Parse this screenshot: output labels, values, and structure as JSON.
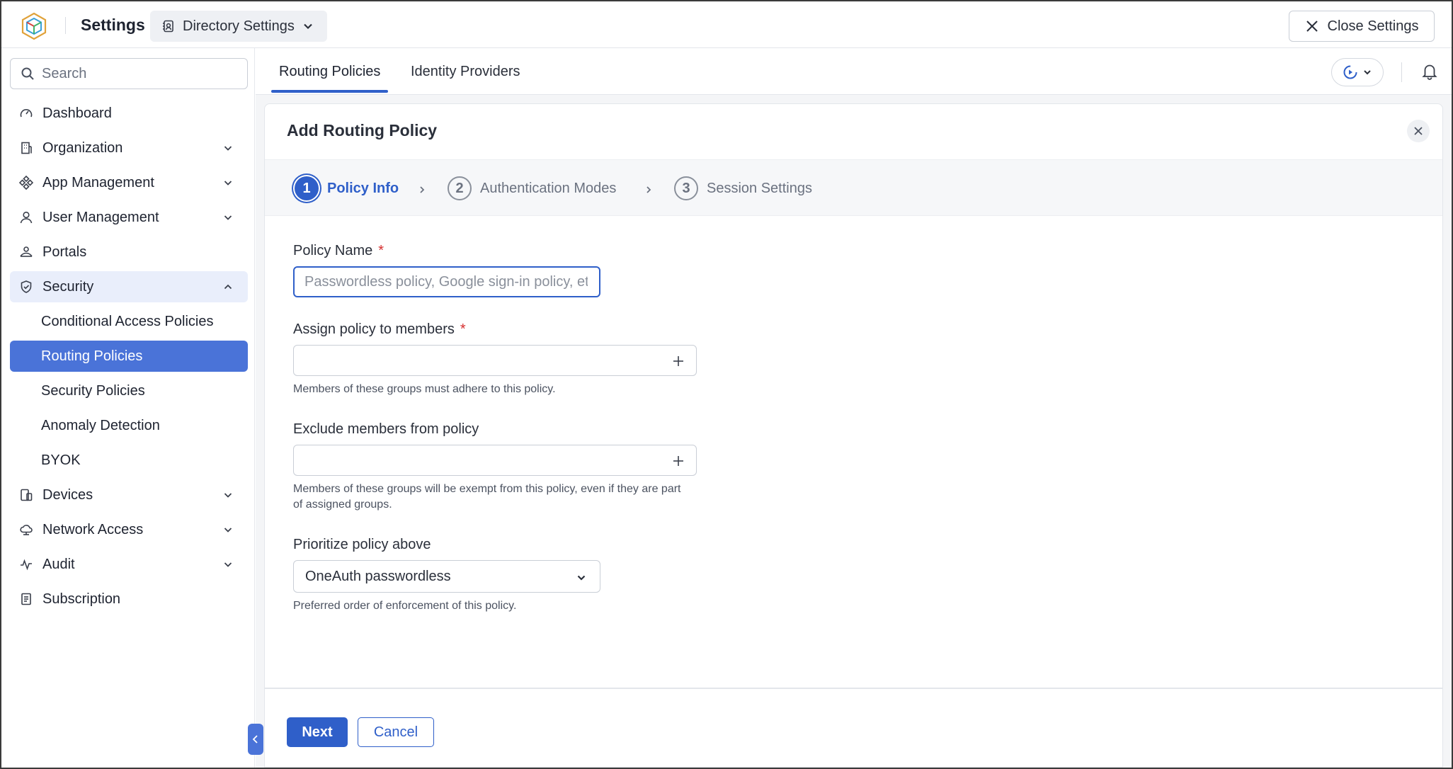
{
  "header": {
    "app_title": "Settings",
    "directory_switch": "Directory Settings",
    "close_label": "Close Settings"
  },
  "sidebar": {
    "search_placeholder": "Search",
    "items": [
      {
        "label": "Dashboard",
        "icon": "gauge-icon"
      },
      {
        "label": "Organization",
        "icon": "building-icon"
      },
      {
        "label": "App Management",
        "icon": "apps-icon"
      },
      {
        "label": "User Management",
        "icon": "user-icon"
      },
      {
        "label": "Portals",
        "icon": "portal-icon"
      },
      {
        "label": "Security",
        "icon": "shield-icon"
      },
      {
        "label": "Devices",
        "icon": "devices-icon"
      },
      {
        "label": "Network Access",
        "icon": "cloud-icon"
      },
      {
        "label": "Audit",
        "icon": "activity-icon"
      },
      {
        "label": "Subscription",
        "icon": "document-icon"
      }
    ],
    "security_subitems": [
      "Conditional Access Policies",
      "Routing Policies",
      "Security Policies",
      "Anomaly Detection",
      "BYOK"
    ],
    "accent": "#4a73d8"
  },
  "tabs": {
    "routing": "Routing Policies",
    "idp": "Identity Providers"
  },
  "panel": {
    "title": "Add Routing Policy",
    "steps": [
      {
        "num": "1",
        "label": "Policy Info"
      },
      {
        "num": "2",
        "label": "Authentication Modes"
      },
      {
        "num": "3",
        "label": "Session Settings"
      }
    ],
    "policy_name": {
      "label": "Policy Name",
      "required": "*",
      "placeholder": "Passwordless policy, Google sign-in policy, etc",
      "value": ""
    },
    "assign": {
      "label": "Assign policy to members",
      "required": "*",
      "hint": "Members of these groups must adhere to this policy."
    },
    "exclude": {
      "label": "Exclude members from policy",
      "hint": "Members of these groups will be exempt from this policy, even if they are part of assigned groups."
    },
    "prioritize": {
      "label": "Prioritize policy above",
      "value": "OneAuth passwordless",
      "hint": "Preferred order of enforcement of this policy."
    },
    "next_label": "Next",
    "cancel_label": "Cancel",
    "primary_color": "#2f5fc9",
    "required_color": "#d62e2e"
  }
}
